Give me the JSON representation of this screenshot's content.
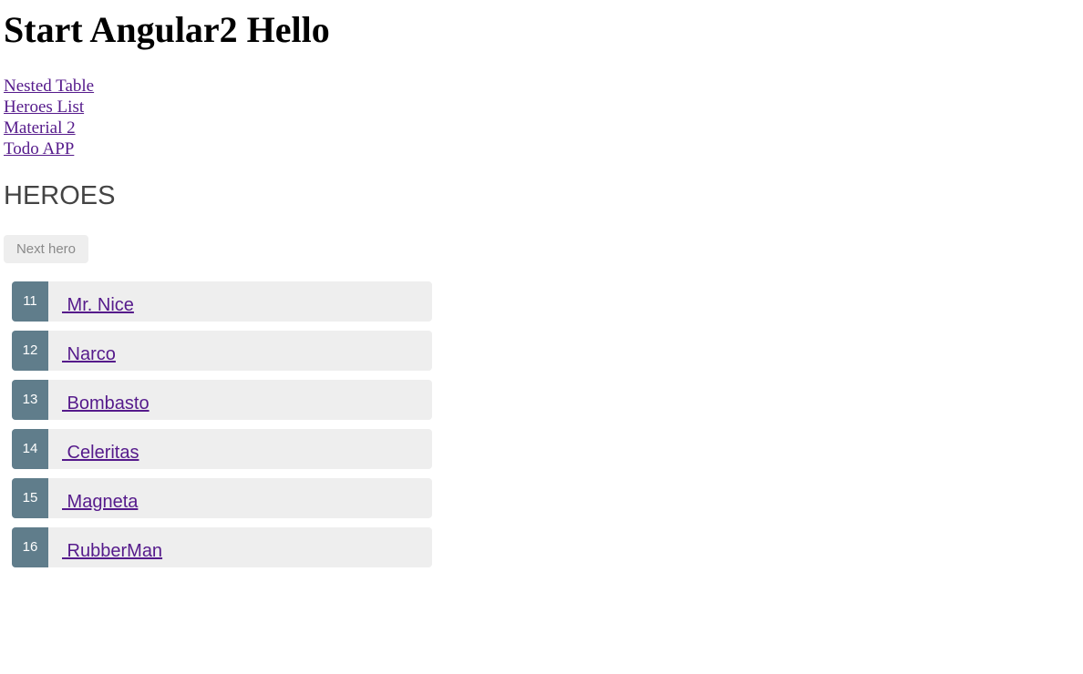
{
  "page": {
    "title": "Start Angular2 Hello"
  },
  "nav": {
    "links": [
      {
        "label": "Nested Table"
      },
      {
        "label": "Heroes List"
      },
      {
        "label": "Material 2"
      },
      {
        "label": "Todo APP"
      }
    ]
  },
  "heroes_section": {
    "title": "HEROES",
    "next_button_label": "Next hero",
    "items": [
      {
        "id": "11",
        "name": " Mr. Nice"
      },
      {
        "id": "12",
        "name": " Narco"
      },
      {
        "id": "13",
        "name": " Bombasto"
      },
      {
        "id": "14",
        "name": " Celeritas"
      },
      {
        "id": "15",
        "name": " Magneta"
      },
      {
        "id": "16",
        "name": " RubberMan"
      }
    ]
  },
  "colors": {
    "badge_background": "#607d8b",
    "item_background": "#eeeeee",
    "link": "#551a8b",
    "section_title": "#444444"
  }
}
